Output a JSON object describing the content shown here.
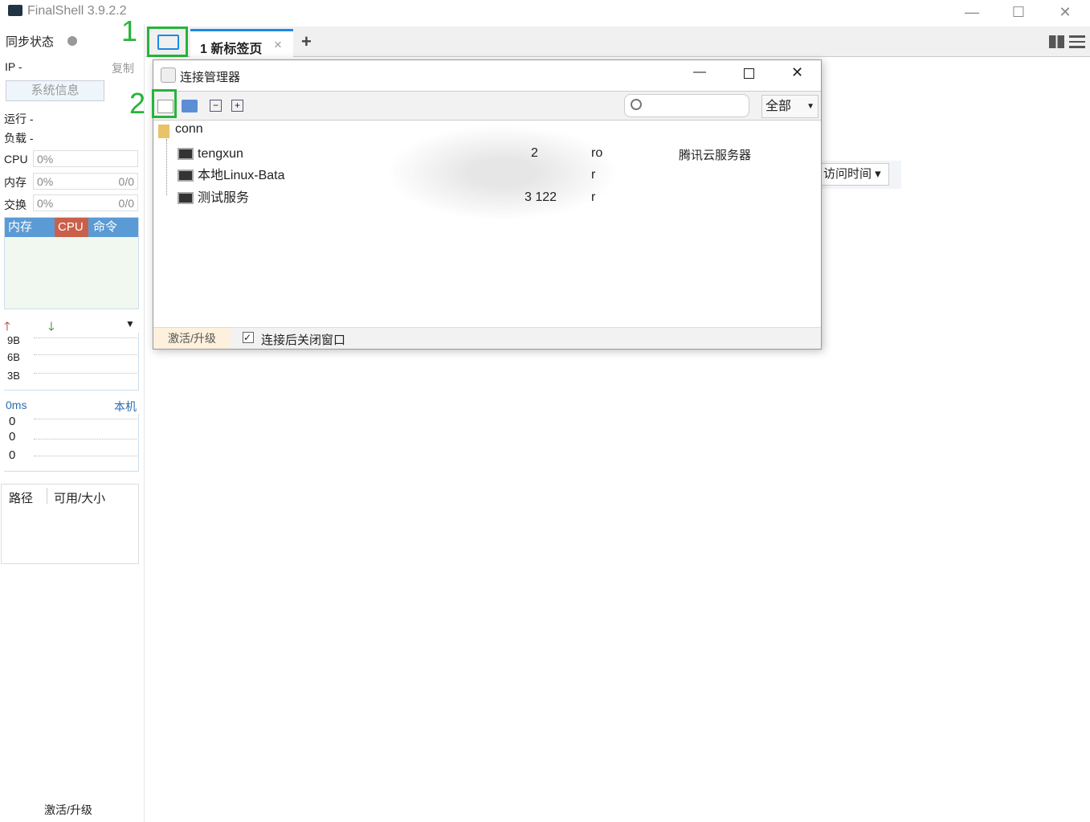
{
  "app": {
    "title": "FinalShell 3.9.2.2"
  },
  "window_controls": {
    "minimize": "—",
    "maximize": "☐",
    "close": "✕"
  },
  "sidebar": {
    "sync_label": "同步状态",
    "ip_label": "IP  -",
    "copy": "复制",
    "sysinfo": "系统信息",
    "run": "运行 -",
    "load": "负载 -",
    "cpu": {
      "label": "CPU",
      "value": "0%"
    },
    "mem": {
      "label": "内存",
      "value": "0%",
      "ratio": "0/0"
    },
    "swap": {
      "label": "交换",
      "value": "0%",
      "ratio": "0/0"
    },
    "tabs": [
      "内存",
      "CPU",
      "命令"
    ],
    "net_ticks": [
      "9B",
      "6B",
      "3B"
    ],
    "latency": "0ms",
    "host": "本机",
    "lat_ticks": [
      "0",
      "0",
      "0"
    ],
    "disk_cols": [
      "路径",
      "可用/大小"
    ],
    "activate": "激活/升级"
  },
  "annotations": [
    "1",
    "2"
  ],
  "tabbar": {
    "tab": "1 新标签页",
    "close": "×",
    "add": "+"
  },
  "background": {
    "sort": "访问时间"
  },
  "dialog": {
    "title": "连接管理器",
    "filter": "全部",
    "search_placeholder": "",
    "folder": "conn",
    "rows": [
      {
        "name": "tengxun",
        "port": "2",
        "user": "ro",
        "note": "腾讯云服务器"
      },
      {
        "name": "本地Linux-Bata",
        "port": "",
        "user": "r",
        "note": ""
      },
      {
        "name": "测试服务",
        "port": "3 122",
        "user": "r",
        "note": ""
      }
    ],
    "footer": {
      "activate": "激活/升级",
      "close_after": "连接后关闭窗口",
      "close_after_checked": true
    }
  },
  "colors": {
    "accent": "#27b43a",
    "tab_active": "#1e88e5",
    "cpu_tab": "#c9604b",
    "mem_tab": "#5b9bd5"
  }
}
